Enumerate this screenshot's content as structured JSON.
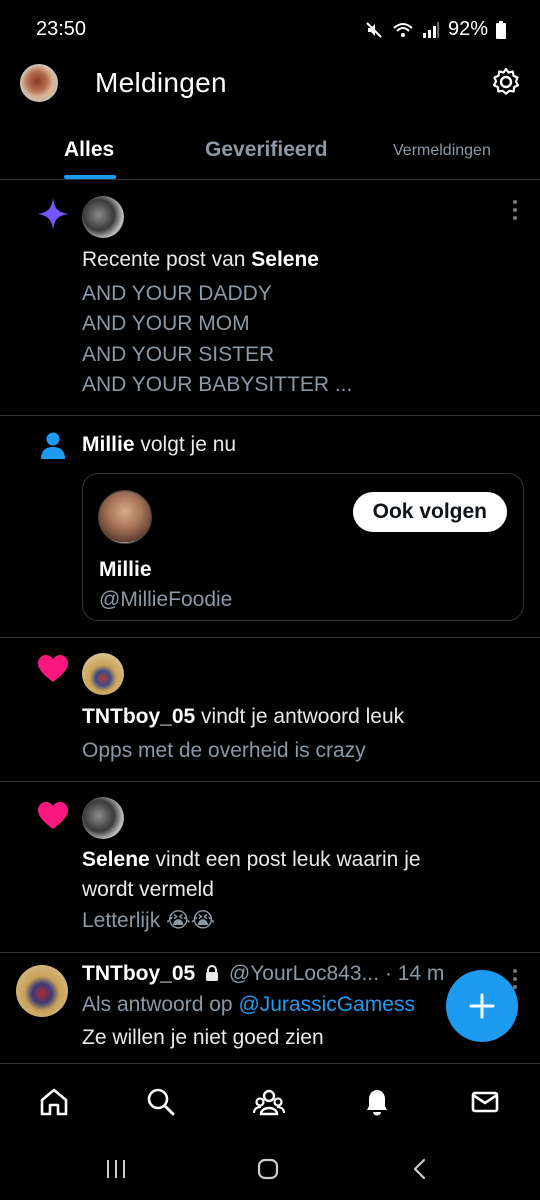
{
  "status": {
    "time": "23:50",
    "battery": "92%"
  },
  "header": {
    "title": "Meldingen"
  },
  "tabs": [
    {
      "label": "Alles",
      "active": true
    },
    {
      "label": "Geverifieerd",
      "active": false
    },
    {
      "label": "Vermeldingen",
      "active": false
    }
  ],
  "notifications": {
    "recent_post": {
      "icon": "sparkle-icon",
      "prefix": "Recente post van ",
      "author": "Selene",
      "lines": [
        "AND YOUR DADDY",
        "AND YOUR MOM",
        "AND YOUR SISTER",
        "AND YOUR BABYSITTER ..."
      ]
    },
    "follow": {
      "icon": "person-icon",
      "name": "Millie",
      "text": " volgt je nu",
      "card_name": "Millie",
      "card_handle": "@MillieFoodie",
      "follow_label": "Ook volgen"
    },
    "like_reply": {
      "icon": "heart-icon",
      "name": "TNTboy_05",
      "text": " vindt je antwoord leuk",
      "sub": "Opps met de overheid is crazy"
    },
    "like_mention": {
      "icon": "heart-icon",
      "name": "Selene",
      "text_line1": " vindt een post leuk waarin je",
      "text_line2": "wordt vermeld",
      "sub": "Letterlijk 😭😭"
    },
    "reply_post": {
      "name": "TNTboy_05",
      "handle": "@YourLoc843...",
      "time": "· 14 m",
      "reply_prefix": "Als antwoord op ",
      "reply_to": "@JurassicGamess",
      "text": "Ze willen je niet goed zien"
    }
  },
  "colors": {
    "accent": "#1d9bf0",
    "like": "#f91880",
    "sparkle": "#7856ff",
    "muted": "#8b98a5"
  }
}
